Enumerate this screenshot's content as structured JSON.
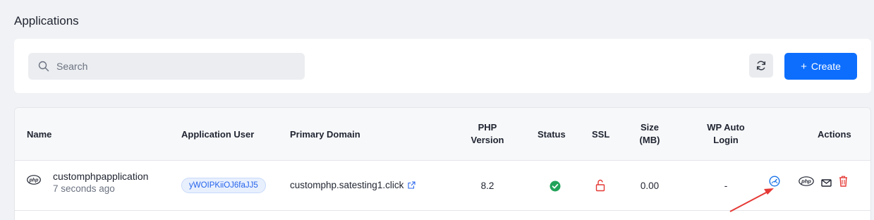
{
  "page": {
    "title": "Applications"
  },
  "toolbar": {
    "search_placeholder": "Search",
    "search_icon": "search-icon",
    "refresh_icon": "refresh-icon",
    "create_label": "Create",
    "create_icon": "plus-icon",
    "accent_color": "#0d6efd"
  },
  "table": {
    "headers": {
      "name": "Name",
      "application_user": "Application User",
      "primary_domain": "Primary Domain",
      "php_version_line1": "PHP",
      "php_version_line2": "Version",
      "status": "Status",
      "ssl": "SSL",
      "size_line1": "Size",
      "size_line2": "(MB)",
      "wp_auto_login_line1": "WP Auto",
      "wp_auto_login_line2": "Login",
      "actions": "Actions"
    },
    "rows": [
      {
        "type_icon": "php-icon",
        "name": "customphpapplication",
        "created": "7 seconds ago",
        "application_user": "yWOIPKiiOJ6faJJ5",
        "primary_domain": "customphp.satesting1.click",
        "domain_icon": "external-link-icon",
        "php_version": "8.2",
        "status_icon": "check-circle-icon",
        "status_color": "#22a35a",
        "ssl_icon": "unlocked-icon",
        "ssl_color": "#e53935",
        "size_mb": "0.00",
        "wp_auto_login": "-",
        "actions": [
          {
            "icon": "speedometer-icon",
            "color": "#1a73e8"
          },
          {
            "icon": "php-icon",
            "color": "#1f2430"
          },
          {
            "icon": "mail-icon",
            "color": "#1f2430"
          },
          {
            "icon": "trash-icon",
            "color": "#e53935"
          }
        ]
      }
    ]
  },
  "annotation": {
    "arrow_color": "#e53935"
  }
}
